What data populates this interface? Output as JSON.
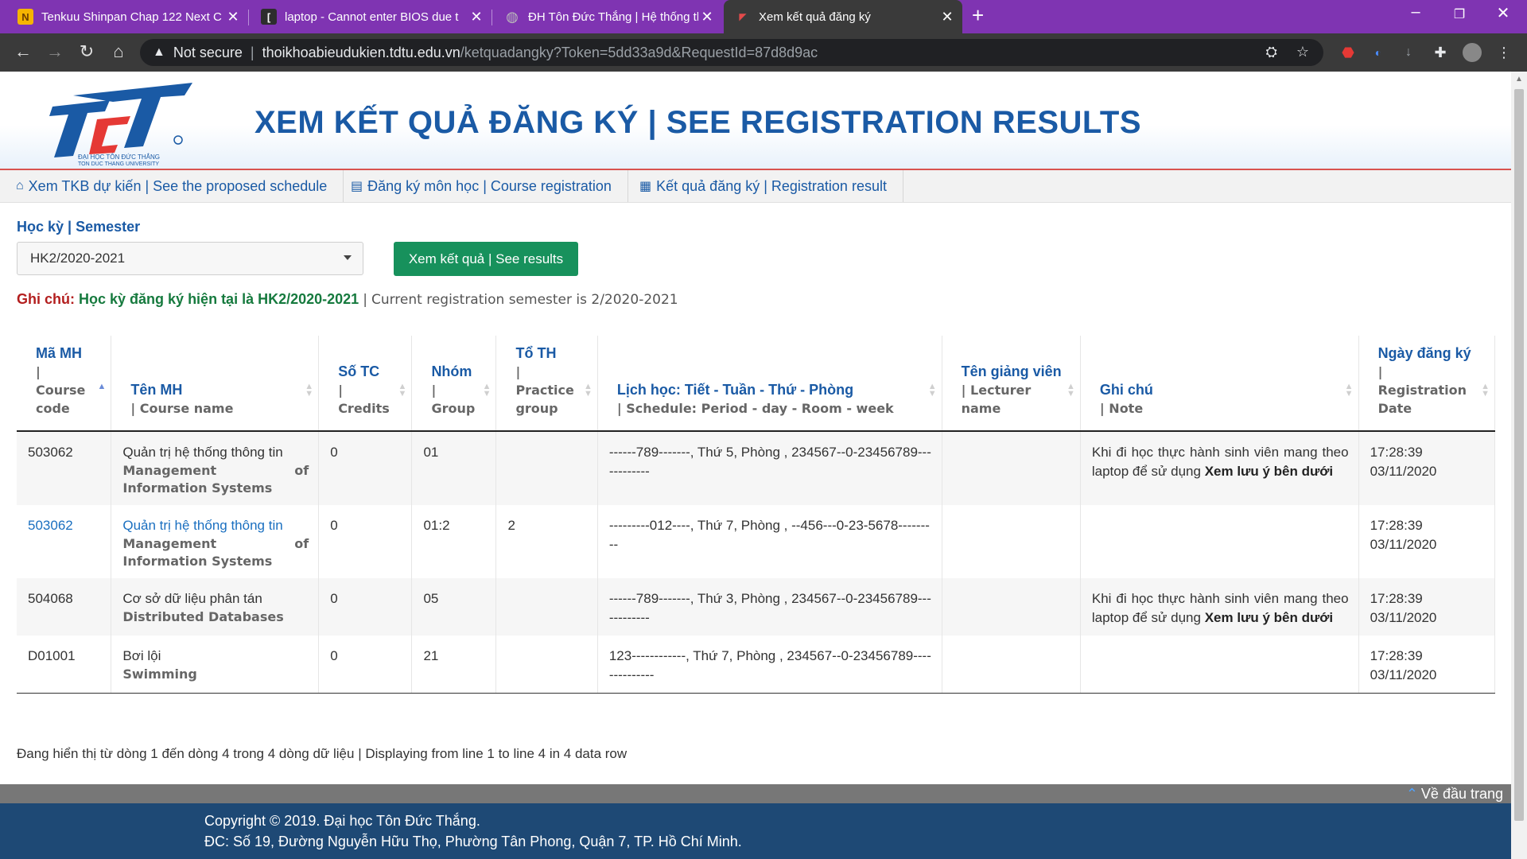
{
  "browser": {
    "tabs": [
      {
        "title": "Tenkuu Shinpan Chap 122 Next C",
        "icon": "N"
      },
      {
        "title": "laptop - Cannot enter BIOS due t",
        "icon": "["
      },
      {
        "title": "ĐH Tôn Đức Thắng | Hệ thống th",
        "icon": "globe"
      },
      {
        "title": "Xem kết quả đăng ký",
        "icon": "tdt"
      }
    ],
    "security_label": "Not secure",
    "url_host": "thoikhoabieudukien.tdtu.edu.vn",
    "url_path": "/ketquadangky?Token=5dd33a9d&RequestId=87d8d9ac"
  },
  "header": {
    "logo_text": "TĐT",
    "logo_caption_1": "ĐẠI HỌC TÔN ĐỨC THẮNG",
    "logo_caption_2": "TON DUC THANG UNIVERSITY",
    "title": "XEM KẾT QUẢ ĐĂNG KÝ | SEE REGISTRATION RESULTS"
  },
  "menu": [
    {
      "label": "Xem TKB dự kiến | See the proposed schedule",
      "icon": "home-icon"
    },
    {
      "label": "Đăng ký môn học | Course registration",
      "icon": "list-icon"
    },
    {
      "label": "Kết quả đăng ký | Registration result",
      "icon": "calendar-icon"
    }
  ],
  "semester": {
    "label": "Học kỳ | Semester",
    "selected": "HK2/2020-2021",
    "button": "Xem kết quả | See results"
  },
  "note": {
    "prefix": "Ghi chú:",
    "main": "Học kỳ đăng ký hiện tại là HK2/2020-2021",
    "sep": "|",
    "english": "Current registration semester is 2/2020-2021"
  },
  "table": {
    "headers": [
      {
        "vi": "Mã MH",
        "en": "Course code"
      },
      {
        "vi": "Tên MH",
        "en": "Course name"
      },
      {
        "vi": "Số TC",
        "en": "Credits"
      },
      {
        "vi": "Nhóm",
        "en": "Group"
      },
      {
        "vi": "Tổ TH",
        "en": "Practice group"
      },
      {
        "vi": "Lịch học: Tiết - Tuần - Thứ - Phòng",
        "en": "Schedule: Period - day - Room - week"
      },
      {
        "vi": "Tên giảng viên",
        "en": "Lecturer name"
      },
      {
        "vi": "Ghi chú",
        "en": "Note"
      },
      {
        "vi": "Ngày đăng ký",
        "en": "Registration Date"
      }
    ],
    "rows": [
      {
        "code": "503062",
        "name_vi": "Quản trị hệ thống thông tin",
        "name_en": "Management of Information Systems",
        "credits": "0",
        "group": "01",
        "practice": "",
        "schedule": "------789-------, Thứ 5, Phòng , 234567--0-23456789------------",
        "lecturer": "",
        "note_text": "Khi đi học thực hành sinh viên mang theo laptop để sử dụng ",
        "note_bold": "Xem lưu ý bên dưới",
        "time": "17:28:39",
        "date": "03/11/2020"
      },
      {
        "code": "503062",
        "name_vi": "Quản trị hệ thống thông tin",
        "name_en": "Management of Information Systems",
        "credits": "0",
        "group": "01:2",
        "practice": "2",
        "schedule": "---------012----, Thứ 7, Phòng , --456---0-23-5678---------",
        "lecturer": "",
        "note_text": "",
        "note_bold": "",
        "time": "17:28:39",
        "date": "03/11/2020"
      },
      {
        "code": "504068",
        "name_vi": "Cơ sở dữ liệu phân tán",
        "name_en": "Distributed Databases",
        "credits": "0",
        "group": "05",
        "practice": "",
        "schedule": "------789-------, Thứ 3, Phòng , 234567--0-23456789------------",
        "lecturer": "",
        "note_text": "Khi đi học thực hành sinh viên mang theo laptop để sử dụng ",
        "note_bold": "Xem lưu ý bên dưới",
        "time": "17:28:39",
        "date": "03/11/2020"
      },
      {
        "code": "D01001",
        "name_vi": "Bơi lội",
        "name_en": "Swimming",
        "credits": "0",
        "group": "21",
        "practice": "",
        "schedule": "123------------, Thứ 7, Phòng , 234567--0-23456789--------------",
        "lecturer": "",
        "note_text": "",
        "note_bold": "",
        "time": "17:28:39",
        "date": "03/11/2020"
      }
    ],
    "display_info": "Đang hiển thị từ dòng 1 đến dòng 4 trong 4 dòng dữ liệu | Displaying from line 1 to line 4 in 4 data row"
  },
  "footer": {
    "to_top": "Về đầu trang",
    "copyright": "Copyright © 2019. Đại học Tôn Đức Thắng.",
    "address": "ĐC: Số 19, Đường Nguyễn Hữu Thọ, Phường Tân Phong, Quận 7, TP. Hồ Chí Minh."
  },
  "colors": {
    "brand_blue": "#1a5aa5",
    "button_green": "#17915c",
    "tabbar_purple": "#7f34b2",
    "footer_blue": "#1e4975"
  }
}
